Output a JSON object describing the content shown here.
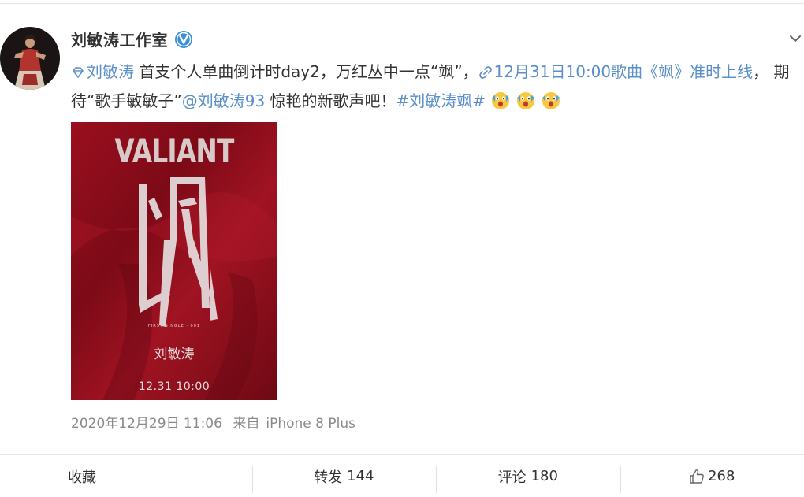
{
  "post": {
    "author": "刘敏涛工作室",
    "text": {
      "topic_link": "刘敏涛",
      "part1": " 首支个人单曲倒计时day2，万红丛中一点“飒”，",
      "date_link": "12月31日10:00歌曲《飒》准时上线",
      "part2": "， 期待“歌手敏敏子”",
      "mention": "@刘敏涛93",
      "part3": " 惊艳的新歌声吧！",
      "hashtag": "#刘敏涛飒#"
    },
    "image": {
      "title": "VALIANT",
      "main_char": "飒",
      "subtitle": "FIRST SINGLE · 001",
      "artist": "刘敏涛",
      "date": "12.31  10:00",
      "background_color": "#8e0d1b"
    },
    "time": "2020年12月29日 11:06",
    "source_prefix": "来自",
    "source_device": "iPhone 8 Plus",
    "emojis": [
      "emoji-shocked-icon",
      "emoji-shocked-icon",
      "emoji-shocked-icon"
    ]
  },
  "footer": {
    "collect_label": "收藏",
    "repost_label": "转发",
    "repost_count": "144",
    "comment_label": "评论",
    "comment_count": "180",
    "like_count": "268"
  },
  "colors": {
    "link": "#5a8fc9",
    "text": "#333333",
    "meta": "#8a8a8a",
    "verified": "#3a8fd8"
  }
}
